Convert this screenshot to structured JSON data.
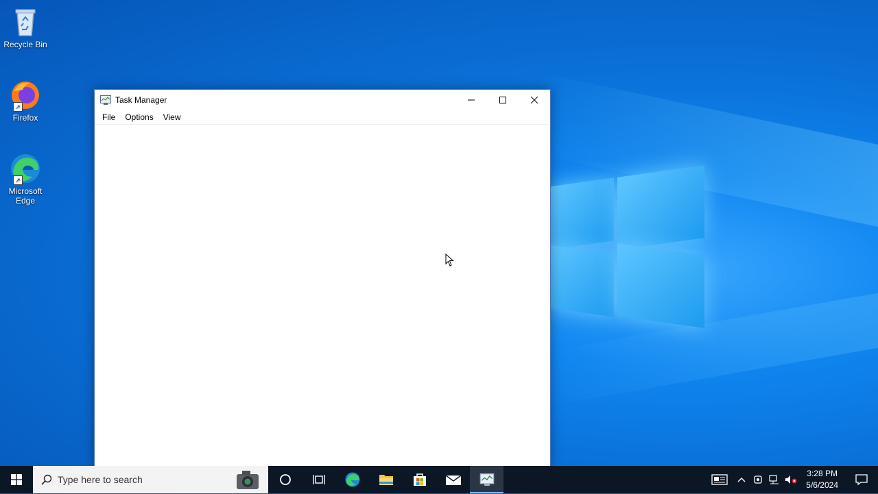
{
  "desktop": {
    "icons": [
      {
        "label": "Recycle Bin",
        "icon": "recycle-bin-icon"
      },
      {
        "label": "Firefox",
        "icon": "firefox-icon"
      },
      {
        "label": "Microsoft Edge",
        "icon": "edge-icon"
      }
    ]
  },
  "window": {
    "title": "Task Manager",
    "menu": [
      "File",
      "Options",
      "View"
    ],
    "controls": [
      "minimize-icon",
      "maximize-icon",
      "close-icon"
    ]
  },
  "taskbar": {
    "search_placeholder": "Type here to search",
    "pinned": [
      "cortana-icon",
      "task-view-icon",
      "edge-icon",
      "file-explorer-icon",
      "store-icon",
      "mail-icon",
      "task-manager-icon"
    ],
    "active_app": "task-manager-icon",
    "clock": {
      "time": "3:28 PM",
      "date": "5/6/2024"
    }
  },
  "colors": {
    "taskbar": "#0c1726",
    "desktop_accent": "#0f86f0"
  }
}
